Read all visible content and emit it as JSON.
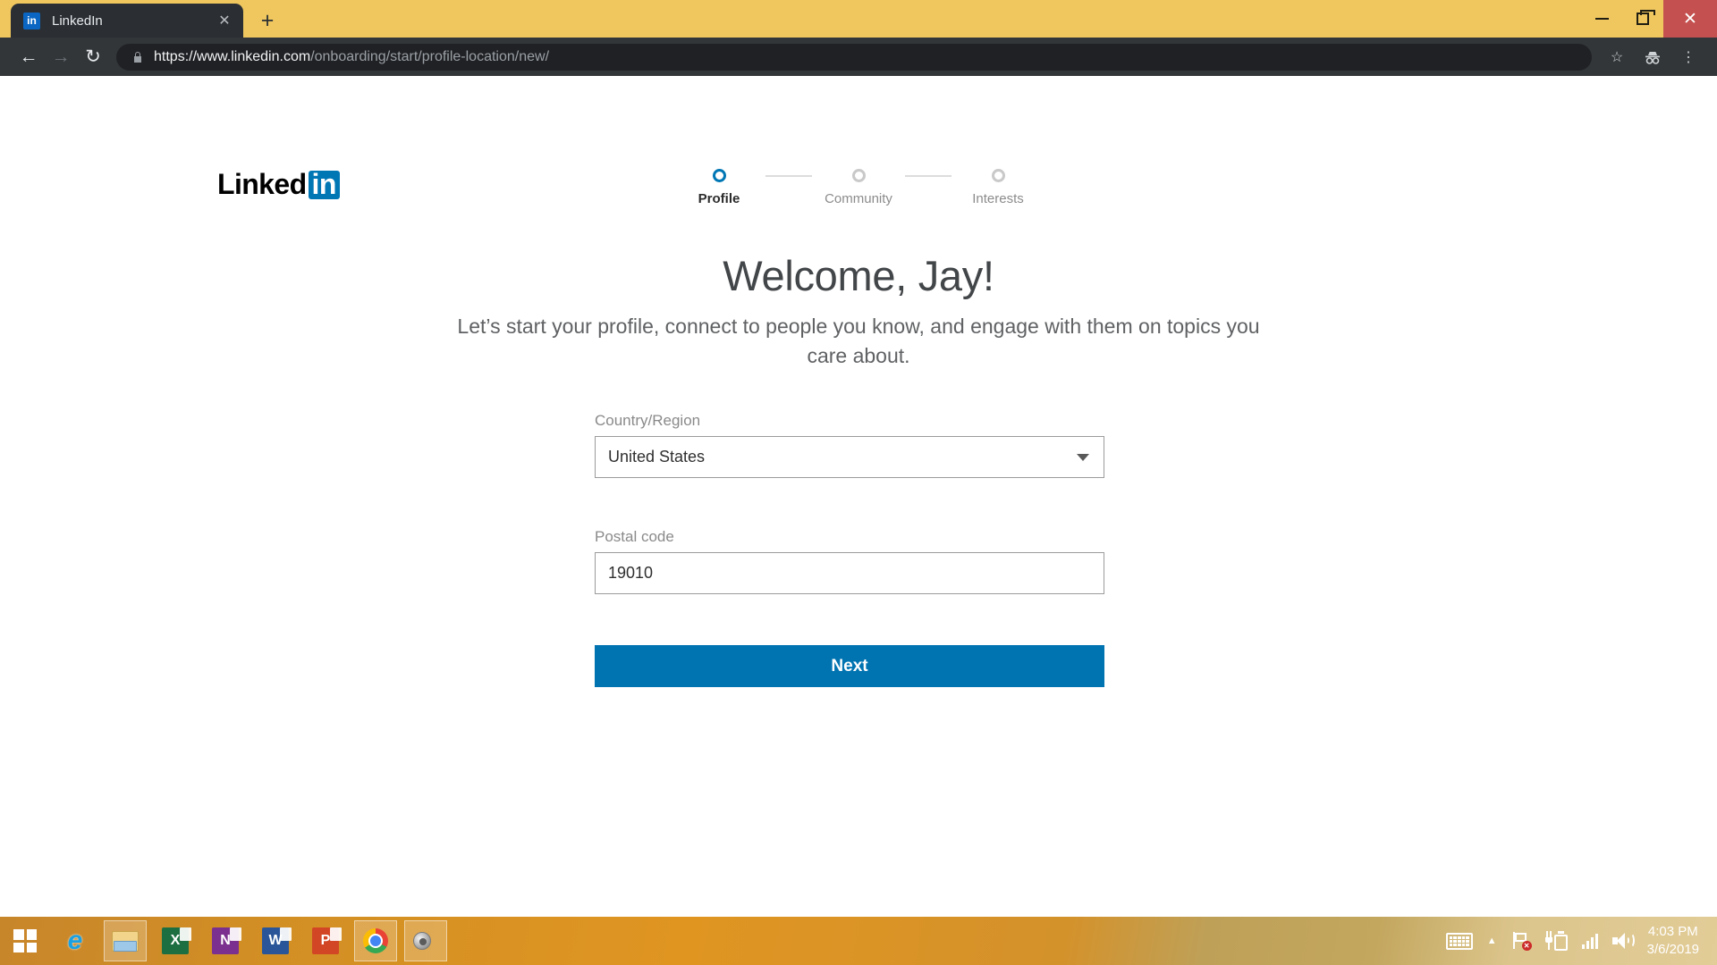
{
  "browser": {
    "tab": {
      "title": "LinkedIn",
      "favicon": "in",
      "close_icon": "close-icon"
    },
    "new_tab_label": "+",
    "window_controls": {
      "minimize": "minimize-icon",
      "maximize": "restore-icon",
      "close": "✕"
    },
    "nav": {
      "back": "←",
      "forward": "→",
      "reload": "↻"
    },
    "omnibox": {
      "lock_icon": "lock-icon",
      "url_host": "https://www.linkedin.com",
      "url_path": "/onboarding/start/profile-location/new/"
    },
    "toolbar_right": {
      "bookmark": "☆",
      "incognito": "incognito-icon",
      "menu": "⋮"
    },
    "titlebar_color": "#efc75e",
    "toolbar_color": "#323639"
  },
  "page": {
    "logo": {
      "text": "Linked",
      "badge": "in",
      "badge_color": "#0077b5"
    },
    "stepper": {
      "steps": [
        {
          "label": "Profile",
          "state": "active"
        },
        {
          "label": "Community",
          "state": "inactive"
        },
        {
          "label": "Interests",
          "state": "inactive"
        }
      ],
      "active_color": "#0077b5",
      "inactive_color": "#c9c9c9"
    },
    "headline": "Welcome, Jay!",
    "subhead": "Let’s start your profile, connect to people you know, and engage with them on topics you care about.",
    "form": {
      "country": {
        "label": "Country/Region",
        "value": "United States",
        "caret_icon": "chevron-down-icon"
      },
      "postal": {
        "label": "Postal code",
        "value": "19010",
        "placeholder": "Postal code"
      },
      "submit": {
        "label": "Next",
        "color": "#0073b1"
      }
    }
  },
  "taskbar": {
    "start": "windows-start-icon",
    "apps": [
      {
        "name": "internet-explorer",
        "glyph": "e",
        "open": false
      },
      {
        "name": "file-explorer",
        "glyph": "",
        "open": true
      },
      {
        "name": "excel",
        "glyph": "X",
        "open": false
      },
      {
        "name": "onenote",
        "glyph": "N",
        "open": false
      },
      {
        "name": "word",
        "glyph": "W",
        "open": false
      },
      {
        "name": "powerpoint",
        "glyph": "P",
        "open": false
      },
      {
        "name": "google-chrome",
        "glyph": "",
        "open": true
      },
      {
        "name": "sound-recorder",
        "glyph": "",
        "open": true
      }
    ],
    "tray": {
      "keyboard": "keyboard-icon",
      "show_hidden": "▲",
      "action_center": "flag-icon",
      "battery": "battery-charging-icon",
      "network": "signal-bars-icon",
      "volume": "speaker-icon",
      "time": "4:03 PM",
      "date": "3/6/2019"
    }
  }
}
